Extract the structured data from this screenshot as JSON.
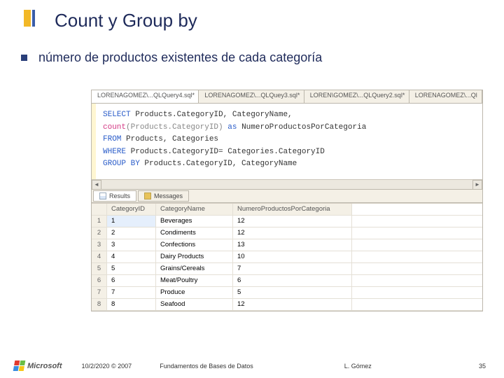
{
  "title": "Count y Group by",
  "subtitle": "número de productos existentes de cada categoría",
  "tabs": [
    "LORENAGOMEZ\\...QLQuery4.sql*",
    "LORENAGOMEZ\\...QLQuey3.sql*",
    "LOREN\\GOMEZ\\...QLQuery2.sql*",
    "LORENAGOMEZ\\...Ql"
  ],
  "sql": {
    "l1a": "SELECT ",
    "l1b": "Products.CategoryID, CategoryName,",
    "l2a": "count",
    "l2b": "(Products.CategoryID) ",
    "l2c": "as ",
    "l2d": "NumeroProductosPorCategoria",
    "l3a": "FROM ",
    "l3b": "Products, Categories",
    "l4a": "WHERE ",
    "l4b": "Products.CategoryID= Categories.CategoryID",
    "l5a": "GROUP BY ",
    "l5b": "Products.CategoryID, CategoryName"
  },
  "result_tabs": {
    "results": "Results",
    "messages": "Messages"
  },
  "columns": {
    "c1": "CategoryID",
    "c2": "CategoryName",
    "c3": "NumeroProductosPorCategoria"
  },
  "rows": [
    {
      "n": "1",
      "id": "1",
      "name": "Beverages",
      "count": "12"
    },
    {
      "n": "2",
      "id": "2",
      "name": "Condiments",
      "count": "12"
    },
    {
      "n": "3",
      "id": "3",
      "name": "Confections",
      "count": "13"
    },
    {
      "n": "4",
      "id": "4",
      "name": "Dairy Products",
      "count": "10"
    },
    {
      "n": "5",
      "id": "5",
      "name": "Grains/Cereals",
      "count": "7"
    },
    {
      "n": "6",
      "id": "6",
      "name": "Meat/Poultry",
      "count": "6"
    },
    {
      "n": "7",
      "id": "7",
      "name": "Produce",
      "count": "5"
    },
    {
      "n": "8",
      "id": "8",
      "name": "Seafood",
      "count": "12"
    }
  ],
  "footer": {
    "logo": "Microsoft",
    "date": "10/2/2020 © 2007",
    "center": "Fundamentos de Bases de Datos",
    "author": "L. Gómez",
    "slide": "35"
  }
}
